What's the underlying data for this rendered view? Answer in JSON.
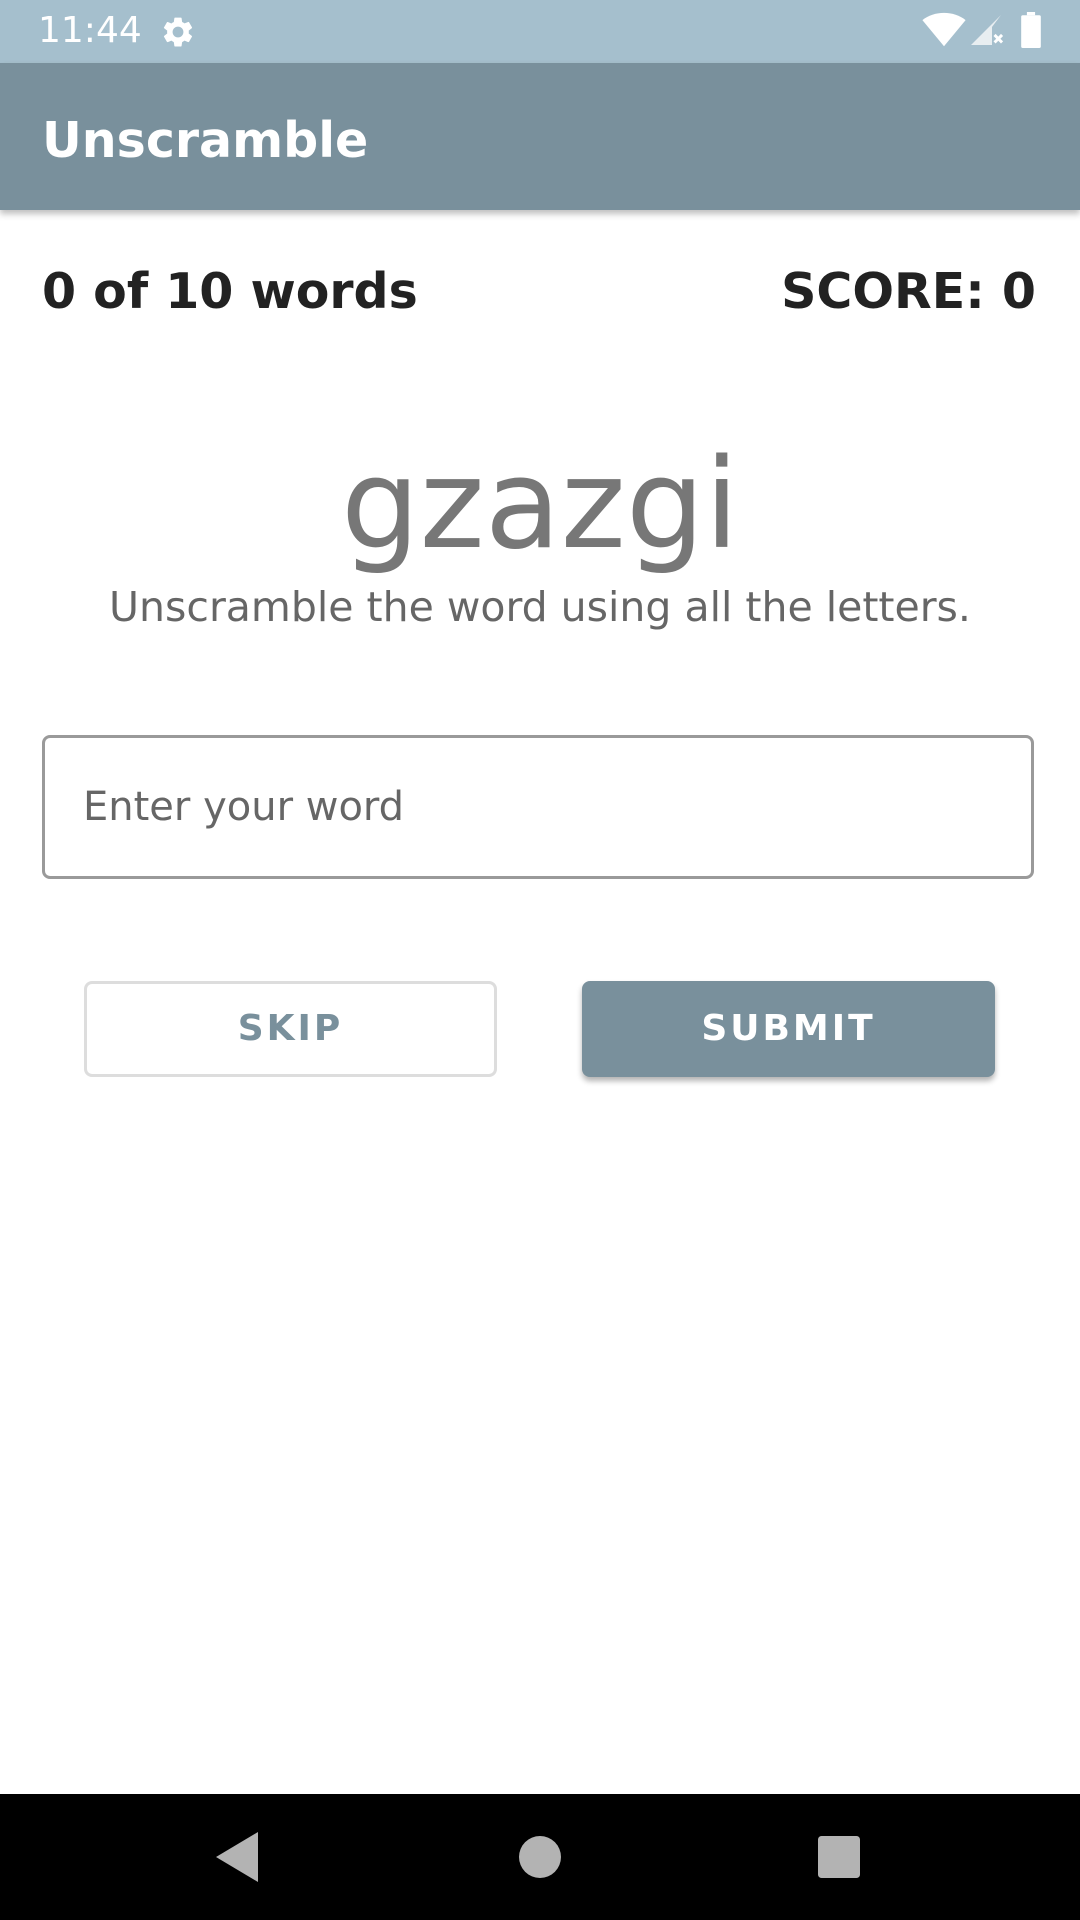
{
  "status_bar": {
    "time": "11:44",
    "icons": [
      "gear-icon",
      "wifi-icon",
      "signal-icon",
      "battery-icon"
    ]
  },
  "app_bar": {
    "title": "Unscramble"
  },
  "game": {
    "word_count": "0 of 10 words",
    "score": "SCORE: 0",
    "scrambled_word": "gzazgi",
    "instructions": "Unscramble the word using all the letters.",
    "input": {
      "value": "",
      "placeholder": "Enter your word"
    },
    "skip_label": "SKIP",
    "submit_label": "SUBMIT"
  },
  "nav_bar": {
    "icons": [
      "back-icon",
      "home-icon",
      "recents-icon"
    ]
  },
  "colors": {
    "status_bar": "#a5bfcd",
    "app_bar": "#79909c",
    "accent": "#79909c"
  }
}
